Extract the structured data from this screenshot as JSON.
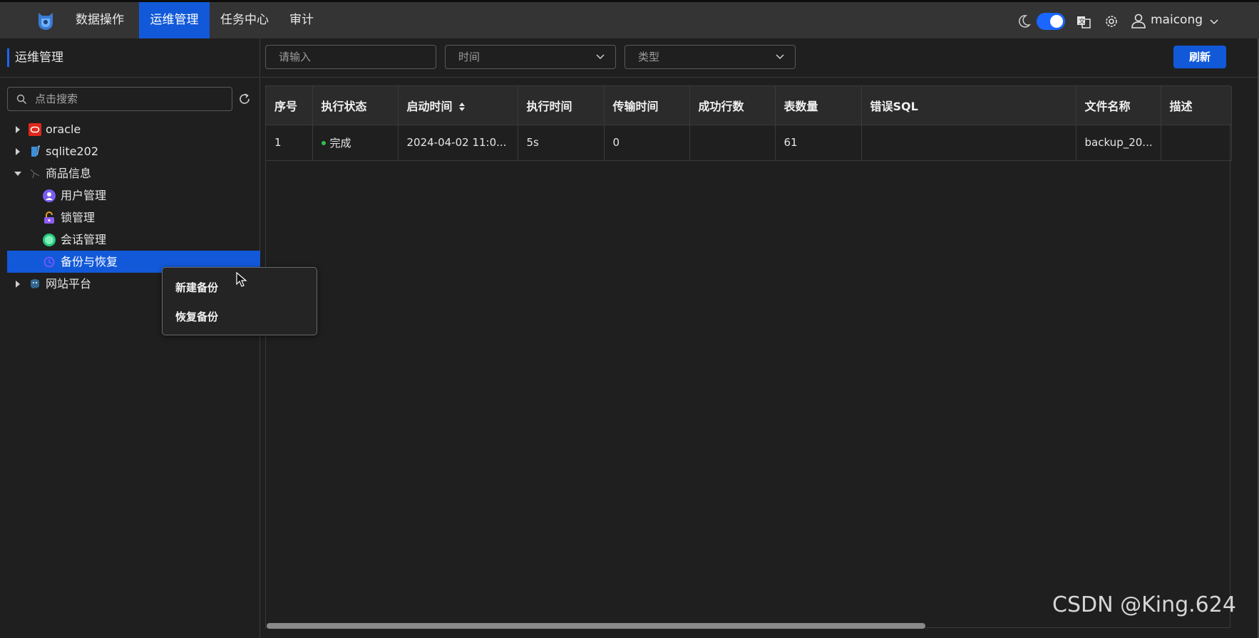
{
  "nav": {
    "items": [
      {
        "label": "数据操作",
        "active": false
      },
      {
        "label": "运维管理",
        "active": true
      },
      {
        "label": "任务中心",
        "active": false
      },
      {
        "label": "审计",
        "active": false
      }
    ],
    "user": "maicong",
    "accent": "#1259d9"
  },
  "sidebar": {
    "title": "运维管理",
    "search_placeholder": "点击搜索",
    "tree": [
      {
        "label": "oracle",
        "icon": "oracle-icon",
        "expanded": false
      },
      {
        "label": "sqlite202",
        "icon": "sqlite-icon",
        "expanded": false
      },
      {
        "label": "商品信息",
        "icon": "database-icon",
        "expanded": true,
        "children": [
          {
            "label": "用户管理",
            "icon": "user-management-icon"
          },
          {
            "label": "锁管理",
            "icon": "lock-icon"
          },
          {
            "label": "会话管理",
            "icon": "session-icon"
          },
          {
            "label": "备份与恢复",
            "icon": "backup-icon",
            "selected": true
          }
        ]
      },
      {
        "label": "网站平台",
        "icon": "postgres-icon",
        "expanded": false
      }
    ]
  },
  "context_menu": {
    "items": [
      "新建备份",
      "恢复备份"
    ]
  },
  "filters": {
    "input_placeholder": "请输入",
    "time_placeholder": "时间",
    "type_placeholder": "类型",
    "refresh_label": "刷新"
  },
  "table": {
    "headers": [
      "序号",
      "执行状态",
      "启动时间",
      "执行时间",
      "传输时间",
      "成功行数",
      "表数量",
      "错误SQL",
      "文件名称",
      "描述"
    ],
    "rows": [
      [
        "1",
        "完成",
        "2024-04-02 11:0...",
        "5s",
        "0",
        "",
        "61",
        "",
        "backup_20...",
        ""
      ]
    ],
    "status_color": "#2fbf4a"
  },
  "watermark": "CSDN @King.624"
}
